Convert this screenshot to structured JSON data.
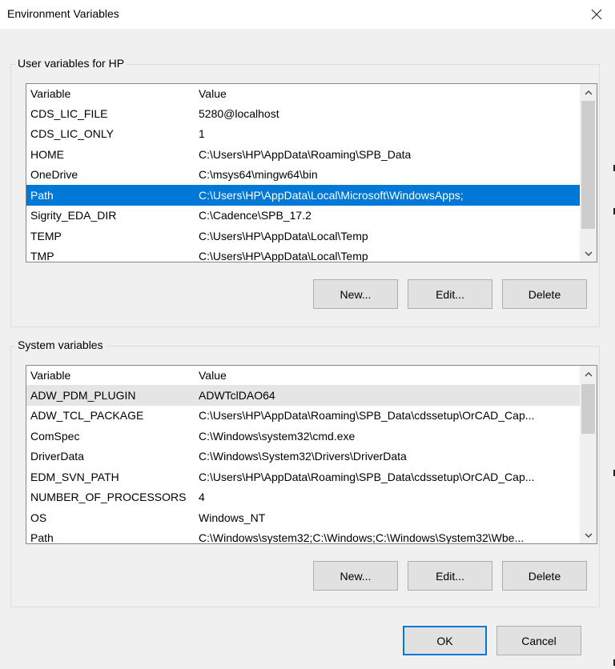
{
  "window": {
    "title": "Environment Variables"
  },
  "user_vars": {
    "group_label": "User variables for HP",
    "header": {
      "variable": "Variable",
      "value": "Value"
    },
    "rows": [
      {
        "variable": "CDS_LIC_FILE",
        "value": "5280@localhost"
      },
      {
        "variable": "CDS_LIC_ONLY",
        "value": "1"
      },
      {
        "variable": "HOME",
        "value": "C:\\Users\\HP\\AppData\\Roaming\\SPB_Data"
      },
      {
        "variable": "OneDrive",
        "value": "C:\\msys64\\mingw64\\bin"
      },
      {
        "variable": "Path",
        "value": "C:\\Users\\HP\\AppData\\Local\\Microsoft\\WindowsApps;"
      },
      {
        "variable": "Sigrity_EDA_DIR",
        "value": "C:\\Cadence\\SPB_17.2"
      },
      {
        "variable": "TEMP",
        "value": "C:\\Users\\HP\\AppData\\Local\\Temp"
      },
      {
        "variable": "TMP",
        "value": "C:\\Users\\HP\\AppData\\Local\\Temp"
      }
    ],
    "selected_index": 4,
    "buttons": {
      "new": "New...",
      "edit": "Edit...",
      "delete": "Delete"
    }
  },
  "system_vars": {
    "group_label": "System variables",
    "header": {
      "variable": "Variable",
      "value": "Value"
    },
    "rows": [
      {
        "variable": "ADW_PDM_PLUGIN",
        "value": "ADWTclDAO64"
      },
      {
        "variable": "ADW_TCL_PACKAGE",
        "value": "C:\\Users\\HP\\AppData\\Roaming\\SPB_Data\\cdssetup\\OrCAD_Cap..."
      },
      {
        "variable": "ComSpec",
        "value": "C:\\Windows\\system32\\cmd.exe"
      },
      {
        "variable": "DriverData",
        "value": "C:\\Windows\\System32\\Drivers\\DriverData"
      },
      {
        "variable": "EDM_SVN_PATH",
        "value": "C:\\Users\\HP\\AppData\\Roaming\\SPB_Data\\cdssetup\\OrCAD_Cap..."
      },
      {
        "variable": "NUMBER_OF_PROCESSORS",
        "value": "4"
      },
      {
        "variable": "OS",
        "value": "Windows_NT"
      },
      {
        "variable": "Path",
        "value": "C:\\Windows\\system32;C:\\Windows;C:\\Windows\\System32\\Wbe..."
      }
    ],
    "hover_index": 0,
    "buttons": {
      "new": "New...",
      "edit": "Edit...",
      "delete": "Delete"
    }
  },
  "footer": {
    "ok": "OK",
    "cancel": "Cancel"
  },
  "colors": {
    "selection": "#0078d7",
    "background": "#f0f0f0",
    "hover": "#e5e5e5"
  },
  "icons": {
    "close": "close-icon",
    "scroll_up": "chevron-up-icon",
    "scroll_down": "chevron-down-icon"
  }
}
